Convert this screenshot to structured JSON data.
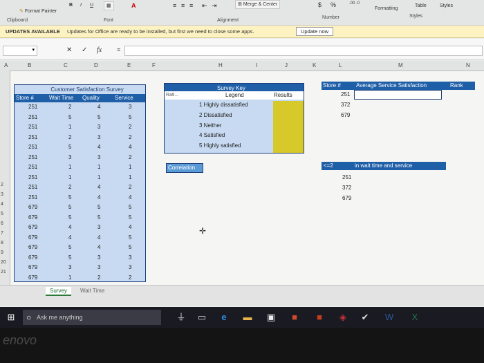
{
  "ribbon": {
    "format_painter": "Format Painter",
    "bold": "B",
    "italic": "I",
    "underline": "U",
    "font_color": "A",
    "merge_center": "Merge & Center",
    "dollar": "$",
    "percent": "%",
    "decimals": ".00 .0",
    "formatting": "Formatting",
    "table": "Table",
    "styles_btn": "Styles",
    "groups": {
      "clipboard": "Clipboard",
      "font": "Font",
      "alignment": "Alignment",
      "number": "Number",
      "styles": "Styles"
    }
  },
  "update_bar": {
    "title": "UPDATES AVAILABLE",
    "message": "Updates for Office are ready to be installed, but first we need to close some apps.",
    "button": "Update now"
  },
  "formula_bar": {
    "cancel": "✕",
    "enter": "✓",
    "fx": "fx",
    "equals": "="
  },
  "columns": [
    "A",
    "B",
    "C",
    "D",
    "E",
    "F",
    "H",
    "I",
    "J",
    "K",
    "L",
    "M",
    "N"
  ],
  "rows": [
    "3",
    "",
    "",
    "",
    "",
    "",
    "",
    "",
    "",
    "",
    "2",
    "3",
    "4",
    "5",
    "6",
    "7",
    "8",
    "9",
    "20",
    "21"
  ],
  "survey_table": {
    "title": "Customer Satisfaction Survey",
    "headers": [
      "Store #",
      "Wait Time",
      "Quality",
      "Service"
    ],
    "rows": [
      [
        "251",
        "2",
        "4",
        "3"
      ],
      [
        "251",
        "5",
        "5",
        "5"
      ],
      [
        "251",
        "1",
        "3",
        "2"
      ],
      [
        "251",
        "2",
        "3",
        "2"
      ],
      [
        "251",
        "5",
        "4",
        "4"
      ],
      [
        "251",
        "3",
        "3",
        "2"
      ],
      [
        "251",
        "1",
        "1",
        "1"
      ],
      [
        "251",
        "1",
        "1",
        "1"
      ],
      [
        "251",
        "2",
        "4",
        "2"
      ],
      [
        "251",
        "5",
        "4",
        "4"
      ],
      [
        "679",
        "5",
        "5",
        "5"
      ],
      [
        "679",
        "5",
        "5",
        "5"
      ],
      [
        "679",
        "4",
        "3",
        "4"
      ],
      [
        "679",
        "4",
        "4",
        "5"
      ],
      [
        "679",
        "5",
        "4",
        "5"
      ],
      [
        "679",
        "5",
        "3",
        "3"
      ],
      [
        "679",
        "3",
        "3",
        "3"
      ],
      [
        "679",
        "1",
        "2",
        "2"
      ]
    ]
  },
  "survey_key": {
    "title": "Survey Key",
    "rating_label": "Rati...",
    "legend_label": "Legend",
    "results_label": "Results",
    "items": [
      "1 Highly dissatisfied",
      "2 Dissatisfied",
      "3 Neither",
      "4 Satisfied",
      "5 Highly satisfied"
    ]
  },
  "correlation_label": "Correlation",
  "avg_table": {
    "store_label": "Store #",
    "avg_label": "Average Service Satisfaction",
    "rank_label": "Rank",
    "stores": [
      "251",
      "372",
      "679"
    ]
  },
  "wait_table": {
    "title_left": "<=2",
    "title_right": "in wait time and service",
    "stores": [
      "251",
      "372",
      "679"
    ]
  },
  "sheet_tabs": [
    "Survey",
    "Wait Time"
  ],
  "taskbar": {
    "search_placeholder": "Ask me anything"
  },
  "brand": "enovo",
  "colors": {
    "accent_blue": "#1f5fa8",
    "table_fill": "#c7daf1",
    "results_fill": "#d8c92a"
  }
}
